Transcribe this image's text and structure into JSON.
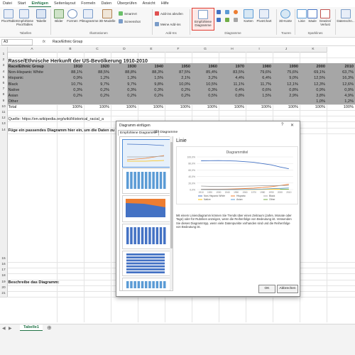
{
  "menu": [
    "Datei",
    "Start",
    "Einfügen",
    "Seitenlayout",
    "Formeln",
    "Daten",
    "Überprüfen",
    "Ansicht",
    "Hilfe"
  ],
  "menu_active": "Einfügen",
  "ribbon": {
    "pivottable": "PivotTable",
    "empfohlene_pivottables": "Empfohlene PivotTables",
    "tabelle": "Tabelle",
    "bilder": "Bilder",
    "formen": "Formen",
    "piktogramme": "Piktogramme",
    "modelle": "3D-Modelle",
    "smartart": "SmartArt",
    "screenshot": "Screenshot",
    "addins_abrufen": "Add-ins abrufen",
    "meine_addins": "Meine Add-ins",
    "empfohlene_diagramme": "Empfohlene Diagramme",
    "karten": "Karten",
    "pivotchart": "PivotChart",
    "karte3d": "3D-Karte",
    "linie": "Linie",
    "saeule": "Säule",
    "gewinn": "Gewinn/ Verlust",
    "datenschnitt": "Datenschn...",
    "groups": {
      "tabellen": "Tabellen",
      "illustrationen": "Illustrationen",
      "addins": "Add-Ins",
      "diagramme": "Diagramme",
      "touren": "Touren",
      "sparklines": "Sparklines"
    }
  },
  "formula_bar": {
    "cell": "A3",
    "fx": "fx",
    "value": "Race/Ethnic Group"
  },
  "columns": [
    "A",
    "B",
    "C",
    "D",
    "E",
    "F",
    "G",
    "H",
    "I",
    "J",
    "K"
  ],
  "rows": {
    "r1": "1",
    "title": "Rasse/Ethnische Herkunft der US-Bevölkerung 1910-2010",
    "header": [
      "Race/Ethnic Group",
      "1910",
      "1920",
      "1930",
      "1940",
      "1950",
      "1960",
      "1970",
      "1980",
      "1990",
      "2000",
      "2010"
    ],
    "data": [
      [
        "Non-Hispanic White",
        "88,1%",
        "88,5%",
        "88,8%",
        "88,3%",
        "87,5%",
        "85,4%",
        "83,5%",
        "79,6%",
        "75,6%",
        "69,1%",
        "63,7%"
      ],
      [
        "Hispanic",
        "0,9%",
        "1,2%",
        "1,3%",
        "1,5%",
        "2,1%",
        "3,2%",
        "4,4%",
        "6,4%",
        "9,0%",
        "12,5%",
        "16,3%"
      ],
      [
        "Black",
        "10,7%",
        "9,7%",
        "9,7%",
        "9,8%",
        "10,0%",
        "10,5%",
        "11,1%",
        "11,7%",
        "12,1%",
        "12,3%",
        "12,6%"
      ],
      [
        "Native",
        "0,3%",
        "0,2%",
        "0,3%",
        "0,3%",
        "0,2%",
        "0,3%",
        "0,4%",
        "0,6%",
        "0,8%",
        "0,9%",
        "0,9%"
      ],
      [
        "Asian",
        "0,2%",
        "0,2%",
        "0,2%",
        "0,2%",
        "0,2%",
        "0,5%",
        "0,8%",
        "1,5%",
        "2,9%",
        "3,8%",
        "4,9%"
      ],
      [
        "Other",
        "",
        "",
        "",
        "",
        "",
        "",
        "",
        "",
        "",
        "1,0%",
        "1,2%"
      ]
    ],
    "total": [
      "Total",
      "100%",
      "100%",
      "100%",
      "100%",
      "100%",
      "100%",
      "100%",
      "100%",
      "100%",
      "100%",
      "100%"
    ],
    "source": "Quelle: https://en.wikipedia.org/wiki/Historical_racial_a",
    "instruction": "Füge ein passendes Diagramm hier ein, um die Daten zu",
    "describe": "Beschreibe das Diagramm:",
    "row_numbers": [
      "1",
      "2",
      "3",
      "4",
      "5",
      "6",
      "7",
      "8",
      "9",
      "10",
      "11",
      "12",
      "13",
      "14",
      "15",
      "16",
      "17",
      "18",
      "19",
      "20",
      "21"
    ]
  },
  "dialog": {
    "title": "Diagramm einfügen",
    "help": "?",
    "close": "✕",
    "tab_recommended": "Empfohlene Diagramme",
    "tab_all": "Alle Diagramme",
    "chart_type": "Linie",
    "chart_title": "Diagrammtitel",
    "y_ticks": [
      "100,0%",
      "80,0%",
      "60,0%",
      "40,0%",
      "20,0%",
      "0,0%"
    ],
    "x_ticks": [
      "1910",
      "1920",
      "1930",
      "1940",
      "1950",
      "1960",
      "1970",
      "1980",
      "1990",
      "2000",
      "2010"
    ],
    "legend": [
      "Non-Hispanic White",
      "Hispanic",
      "Black",
      "Native",
      "Asian",
      "Other"
    ],
    "description": "Mit einem Liniendiagramm können Sie Trends über einen Zeitraum (Jahre, Monate oder Tage) oder für Rubriken anzeigen, wenn die Reihenfolge von Bedeutung ist. Verwenden Sie dieses Diagrammtyp, wenn viele Datenpunkte vorhanden sind und die Reihenfolge von Bedeutung ist.",
    "ok": "OK",
    "cancel": "Abbrechen"
  },
  "series_colors": {
    "white": "#4472c4",
    "hispanic": "#ed7d31",
    "black": "#a5a5a5",
    "native": "#ffc000",
    "asian": "#5b9bd5",
    "other": "#70ad47"
  },
  "sheet_tab": "Tabelle1",
  "accent": "#217346",
  "highlight_box": "#e03c31"
}
